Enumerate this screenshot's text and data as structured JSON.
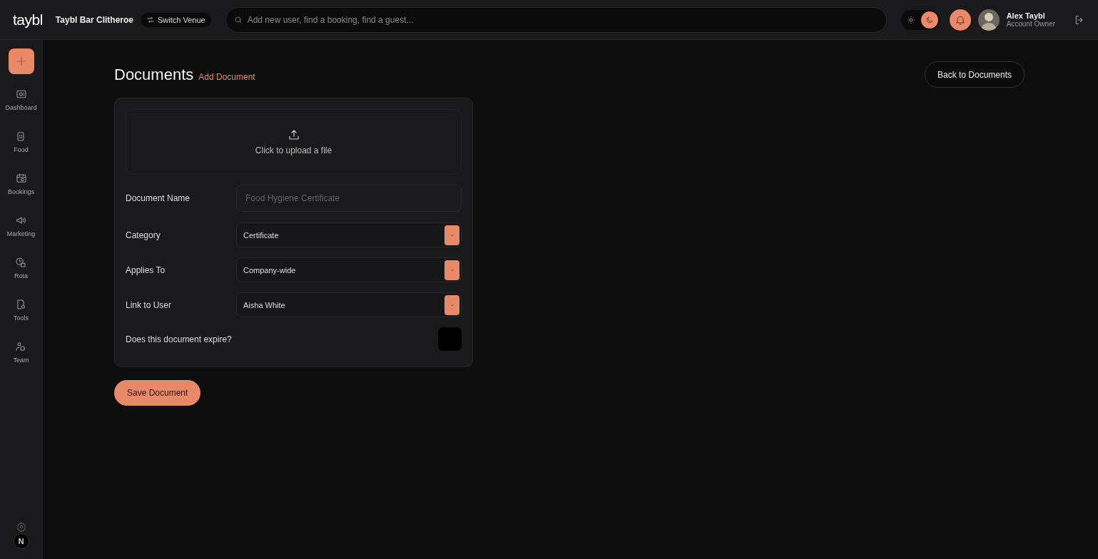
{
  "header": {
    "logo": "taybl",
    "venue": "Taybl Bar Clitheroe",
    "switch_venue": "Switch Venue",
    "search": {
      "placeholder": "Add new user, find a booking, find a guest..."
    },
    "theme": [
      {
        "kind": "light",
        "selected": false
      },
      {
        "kind": "dark",
        "selected": true
      }
    ],
    "user": {
      "name": "Alex Taybl",
      "role": "Account Owner"
    }
  },
  "sidebar": {
    "items": [
      {
        "label": "Dashboard"
      },
      {
        "label": "Food"
      },
      {
        "label": "Bookings"
      },
      {
        "label": "Marketing"
      },
      {
        "label": "Rota"
      },
      {
        "label": "Tools"
      },
      {
        "label": "Team"
      }
    ],
    "dev_badge": "N"
  },
  "page": {
    "title": "Documents",
    "subtitle": "Add Document",
    "back_button": "Back to Documents"
  },
  "form": {
    "upload": "Click to upload a file",
    "fields": [
      {
        "kind": "text",
        "label": "Document Name",
        "placeholder": "Food Hygiene Certificate"
      },
      {
        "kind": "select",
        "label": "Category",
        "value": "Certificate"
      },
      {
        "kind": "select",
        "label": "Applies To",
        "value": "Company-wide"
      },
      {
        "kind": "select",
        "label": "Link to User",
        "value": "Aisha White"
      },
      {
        "kind": "checkbox",
        "label": "Does this document expire?",
        "checked": false
      }
    ],
    "submit": "Save Document"
  }
}
